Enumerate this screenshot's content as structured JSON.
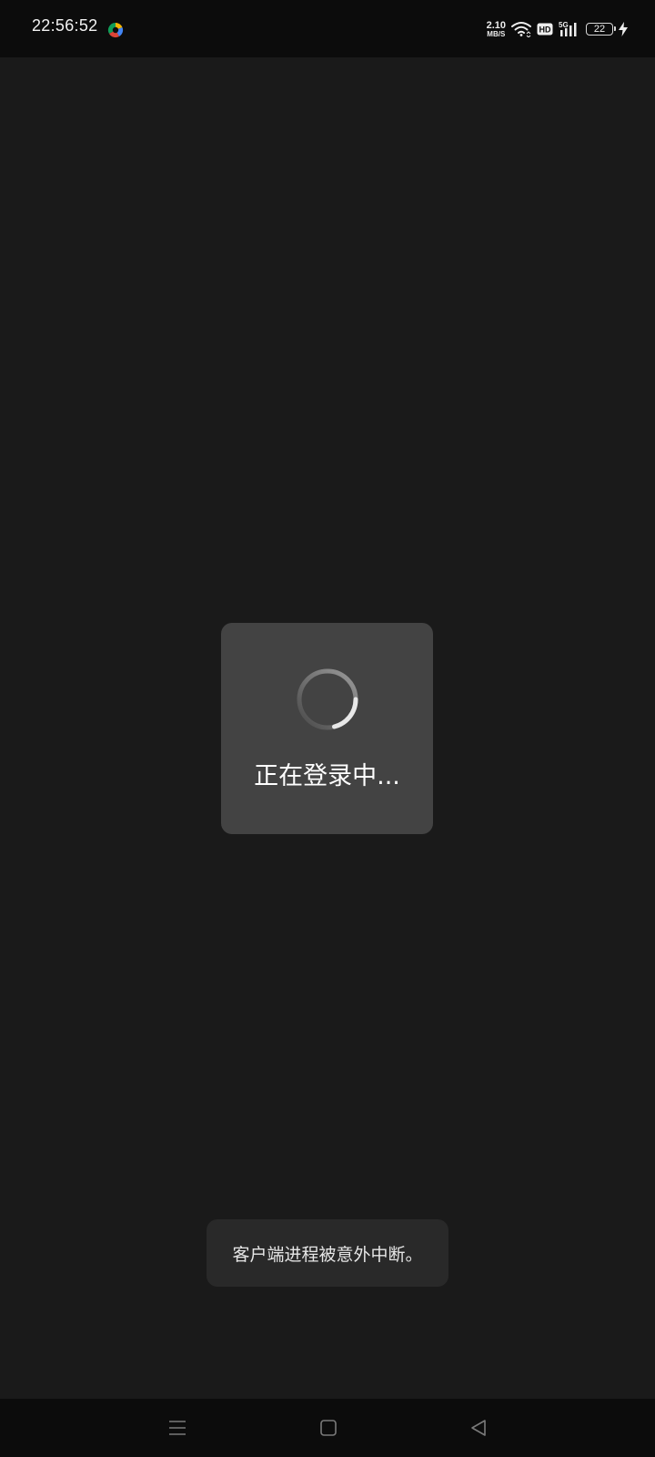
{
  "status_bar": {
    "time": "22:56:52",
    "app_notification_icon": "color-wheel-icon",
    "net_speed_value": "2.10",
    "net_speed_unit": "MB/S",
    "wifi_icon": "wifi-icon",
    "hd_label": "HD",
    "network_type": "5G",
    "signal_icon": "signal-bars-icon",
    "battery_level": "22",
    "charging_icon": "bolt-icon"
  },
  "loading_dialog": {
    "spinner_icon": "spinner-icon",
    "text": "正在登录中..."
  },
  "toast": {
    "text": "客户端进程被意外中断。"
  },
  "nav_bar": {
    "recents_icon": "menu-icon",
    "home_icon": "square-icon",
    "back_icon": "triangle-back-icon"
  },
  "colors": {
    "background": "#1a1a1a",
    "status_bar": "#0c0c0c",
    "dialog": "#434343",
    "toast": "#292929"
  }
}
